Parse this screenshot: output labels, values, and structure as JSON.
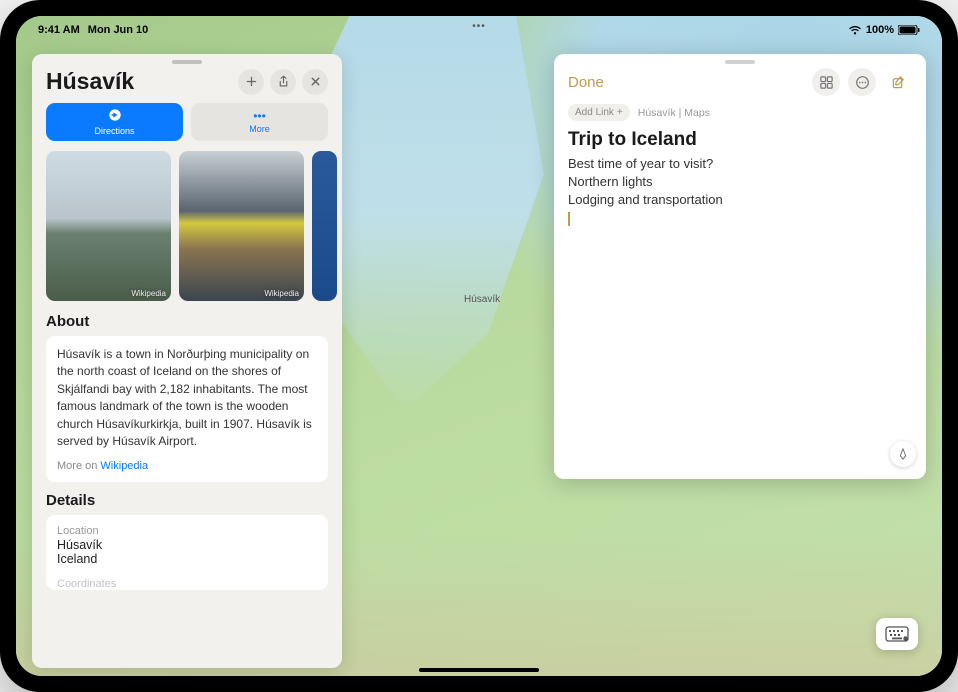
{
  "status": {
    "time": "9:41 AM",
    "date": "Mon Jun 10",
    "battery": "100%"
  },
  "map": {
    "city_label": "Húsavík"
  },
  "maps_card": {
    "title": "Húsavík",
    "directions_label": "Directions",
    "more_label": "More",
    "photo_credit": "Wikipedia",
    "about_heading": "About",
    "about_text": "Húsavík is a town in Norðurþing municipality on the north coast of Iceland on the shores of Skjálfandi bay with 2,182 inhabitants. The most famous landmark of the town is the wooden church Húsavíkurkirkja, built in 1907. Húsavík is served by Húsavík Airport.",
    "more_on_prefix": "More on ",
    "more_on_link": "Wikipedia",
    "details_heading": "Details",
    "location_label": "Location",
    "location_line1": "Húsavík",
    "location_line2": "Iceland",
    "coordinates_label": "Coordinates"
  },
  "notes": {
    "done_label": "Done",
    "add_link_label": "Add Link",
    "breadcrumb": "Húsavík | Maps",
    "title": "Trip to Iceland",
    "lines": [
      "Best time of year to visit?",
      "Northern lights",
      "Lodging and transportation"
    ]
  }
}
